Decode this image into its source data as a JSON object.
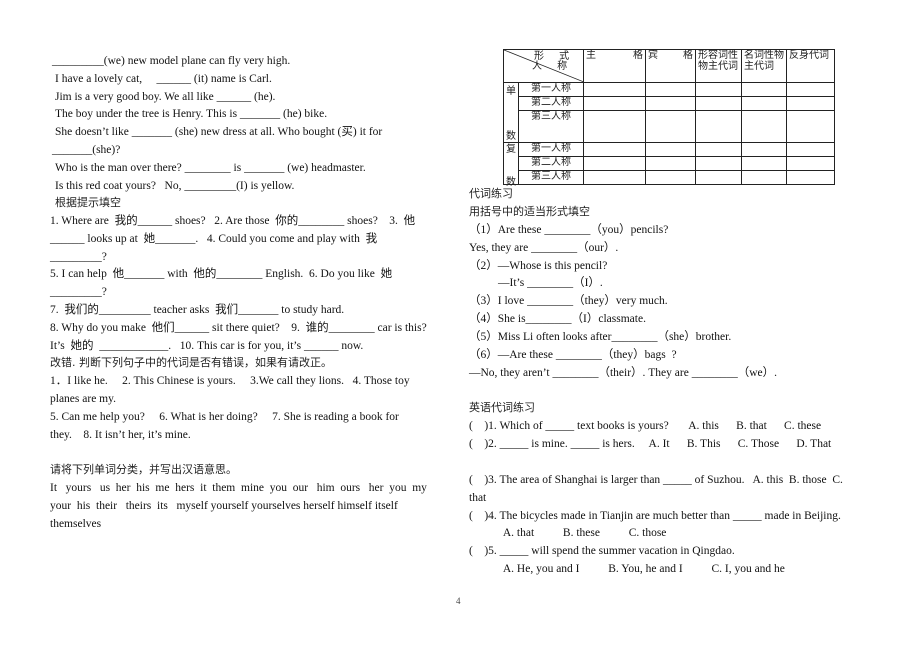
{
  "left_column": {
    "lines": [
      "_________(we) new model plane can fly very high.",
      "I have a lovely cat,     ______ (it) name is Carl.",
      "Jim is a very good boy. We all like ______ (he).",
      "The boy under the tree is Henry. This is _______ (he) bike.",
      "She doesn’t like _______ (she) new dress at all. Who bought (买) it for",
      "_______(she)?",
      "Who is the man over there? ________ is _______ (we) headmaster.",
      "Is this red coat yours?   No, _________(I) is yellow."
    ],
    "section_hint_title": "根据提示填空",
    "hint_lines": [
      "1. Where are  我的______ shoes?   2. Are those  你的________ shoes?    3.  他",
      "______ looks up at  她_______.   4. Could you come and play with  我",
      "_________?",
      "5. I can help  他_______ with  他的________ English.  6. Do you like  她",
      "_________?",
      "7.  我们的_________ teacher asks  我们_______ to study hard.",
      "8. Why do you make  他们______ sit there quiet?    9.  谁的________ car is this?",
      "It’s  她的  ____________.   10. This car is for you, it’s ______ now."
    ],
    "section_correct_title": "改错. 判断下列句子中的代词是否有错误，如果有请改正。",
    "correct_lines": [
      "1．I like he.     2. This Chinese is yours.     3.We call they lions.   4. Those toy",
      "planes are my.",
      "5. Can me help you?     6. What is her doing?     7. She is reading a book for",
      "they.    8. It isn’t her, it’s mine."
    ],
    "section_classify_title": "请将下列单词分类，并写出汉语意思。",
    "classify_lines": [
      "It   yours   us  her  his  me  hers  it  them  mine  you  our   him  ours   her  you  my",
      "your  his  their   theirs  its   myself yourself yourselves herself himself itself",
      "themselves"
    ]
  },
  "pronoun_table": {
    "diag_top": "形 式",
    "diag_bottom": "人 称",
    "headers": [
      {
        "a": "主",
        "b": "格"
      },
      {
        "a": "宾",
        "b": "格"
      },
      {
        "text": "形容词性物主代词"
      },
      {
        "text": "名词性物主代词"
      },
      {
        "text": "反身代词"
      }
    ],
    "singular_label_top": "单",
    "singular_label_bottom": "数",
    "plural_label_top": "复",
    "plural_label_bottom": "数",
    "persons": [
      "第一人称",
      "第二人称",
      "第三人称"
    ]
  },
  "right_column": {
    "section_title": "代词练习",
    "instruction": "用括号中的适当形式填空",
    "exercise_lines": [
      "（1）Are these ________（you）pencils?",
      "Yes, they are ________（our）.",
      "（2）—Whose is this pencil?",
      "—It’s ________（I）.",
      "（3）I love ________（they）very much.",
      "（4）She is________（I）classmate.",
      "（5）Miss Li often looks after________（she）brother.",
      "（6）—Are these ________（they）bags  ?",
      "—No, they aren’t ________（their）. They are ________（we）."
    ],
    "quiz_title": "英语代词练习",
    "quiz_lines": [
      "(    )1. Which of _____ text books is yours?       A. this      B. that      C. these",
      "(    )2. _____ is mine. _____ is hers.     A. It      B. This      C. Those      D. That",
      "",
      "(    )3. The area of Shanghai is larger than _____ of Suzhou.   A. this  B. those  C.",
      "that",
      "(    )4. The bicycles made in Tianjin are much better than _____ made in Beijing.",
      "            A. that          B. these          C. those",
      "(    )5. _____ will spend the summer vacation in Qingdao.",
      "            A. He, you and I          B. You, he and I          C. I, you and he"
    ]
  },
  "page_number": "4"
}
